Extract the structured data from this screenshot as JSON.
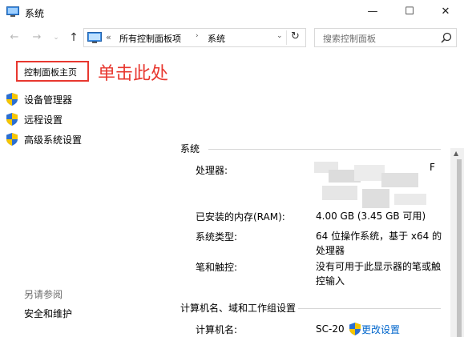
{
  "window": {
    "title": "系统",
    "minimize_glyph": "—",
    "maximize_glyph": "☐",
    "close_glyph": "✕"
  },
  "nav": {
    "back_glyph": "←",
    "forward_glyph": "→",
    "recent_glyph": "⌄",
    "up_glyph": "↑"
  },
  "address": {
    "overflow": "«",
    "crumbs": [
      "所有控制面板项",
      "系统"
    ],
    "crumb_separator": "›",
    "dropdown_glyph": "⌄",
    "refresh_glyph": "↻"
  },
  "search": {
    "placeholder": "搜索控制面板"
  },
  "sidebar": {
    "home": "控制面板主页",
    "annotation": "单击此处",
    "items": [
      {
        "label": "设备管理器",
        "icon": "uac-shield-icon"
      },
      {
        "label": "远程设置",
        "icon": "uac-shield-icon"
      },
      {
        "label": "高级系统设置",
        "icon": "uac-shield-icon"
      }
    ],
    "see_also": "另请参阅",
    "security": "安全和维护"
  },
  "system": {
    "section_title": "系统",
    "processor_label": "处理器:",
    "processor_value_tail": "F",
    "ram_label": "已安装的内存(RAM):",
    "ram_value": "4.00 GB (3.45 GB 可用)",
    "type_label": "系统类型:",
    "type_value": "64 位操作系统，基于 x64 的处理器",
    "pen_label": "笔和触控:",
    "pen_value": "没有可用于此显示器的笔或触控输入"
  },
  "computer": {
    "section_title": "计算机名、域和工作组设置",
    "name_label": "计算机名:",
    "name_value": "SC-20",
    "change_settings": "更改设置"
  },
  "scrollbar": {
    "up_glyph": "▲"
  },
  "colors": {
    "annotation_red": "#e8372f",
    "link_blue": "#0066cc",
    "shield_blue": "#2c6fd1",
    "shield_yellow": "#f7c600"
  }
}
